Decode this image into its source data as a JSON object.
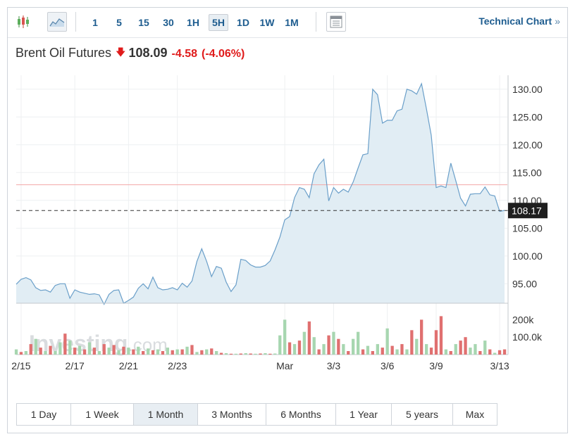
{
  "toolbar": {
    "icons": [
      "candlestick-icon",
      "area-chart-icon",
      "layout-icon"
    ],
    "intervals": [
      "1",
      "5",
      "15",
      "30",
      "1H",
      "5H",
      "1D",
      "1W",
      "1M"
    ],
    "active_interval": "5H",
    "technical_chart_label": "Technical Chart",
    "technical_chart_chevron": "»"
  },
  "quote": {
    "name": "Brent Oil Futures",
    "direction": "down",
    "price": "108.09",
    "change": "-4.58",
    "change_pct": "(-4.06%)"
  },
  "watermark": {
    "brand": "Investing",
    "suffix": ".com"
  },
  "ranges": [
    "1 Day",
    "1 Week",
    "1 Month",
    "3 Months",
    "6 Months",
    "1 Year",
    "5 years",
    "Max"
  ],
  "active_range": "1 Month",
  "colors": {
    "line": "#6a9fc9",
    "area_fill": "#e1edf4",
    "prev_close_line": "#f2a7a7",
    "vol_up": "#a7d6b0",
    "vol_down": "#e07070",
    "accent": "#1d5c8f",
    "down": "#e01b1b"
  },
  "chart_data": {
    "type": "area",
    "series_name": "",
    "price_axis": {
      "ticks": [
        "130.00",
        "125.00",
        "120.00",
        "115.00",
        "110.00",
        "105.00",
        "100.00",
        "95.00"
      ],
      "range": [
        91.5,
        132.5
      ]
    },
    "current_price_label": "108.17",
    "current_price": 108.17,
    "reference_line": 112.8,
    "volume_axis": {
      "ticks": [
        "200k",
        "100.0k"
      ],
      "range": [
        0,
        270
      ]
    },
    "x_ticks": [
      {
        "label": "2/15",
        "index": 1
      },
      {
        "label": "2/17",
        "index": 12
      },
      {
        "label": "2/21",
        "index": 23
      },
      {
        "label": "2/23",
        "index": 33
      },
      {
        "label": "Mar",
        "index": 55
      },
      {
        "label": "3/3",
        "index": 65
      },
      {
        "label": "3/6",
        "index": 76
      },
      {
        "label": "3/9",
        "index": 86
      },
      {
        "label": "3/13",
        "index": 99
      }
    ],
    "values": [
      94.9,
      95.8,
      96.1,
      95.7,
      94.3,
      93.8,
      93.9,
      93.5,
      94.7,
      95.0,
      95.0,
      92.4,
      93.9,
      93.5,
      93.3,
      93.1,
      93.2,
      93.0,
      91.3,
      93.1,
      93.8,
      93.9,
      91.5,
      92.0,
      92.6,
      94.2,
      95.0,
      94.1,
      96.2,
      94.3,
      93.9,
      94.0,
      94.3,
      93.9,
      95.1,
      94.4,
      95.5,
      99.0,
      101.3,
      99.0,
      96.3,
      98.1,
      97.8,
      95.3,
      93.6,
      94.8,
      99.4,
      99.2,
      98.4,
      98.0,
      98.0,
      98.3,
      99.1,
      101.1,
      103.4,
      106.5,
      107.1,
      110.5,
      112.3,
      112.0,
      110.5,
      114.8,
      116.4,
      117.4,
      109.9,
      112.3,
      111.3,
      112.0,
      111.5,
      113.3,
      115.8,
      118.2,
      118.4,
      130.0,
      129.0,
      123.9,
      124.4,
      124.4,
      126.1,
      126.4,
      130.0,
      129.7,
      129.1,
      131.0,
      126.5,
      121.7,
      112.3,
      112.6,
      112.3,
      116.7,
      113.6,
      110.4,
      109.0,
      111.1,
      111.2,
      111.2,
      112.4,
      111.0,
      110.8,
      108.0,
      108.2
    ],
    "volume": [
      {
        "v": 30,
        "up": true
      },
      {
        "v": 15,
        "up": false
      },
      {
        "v": 20,
        "up": true
      },
      {
        "v": 60,
        "up": false
      },
      {
        "v": 90,
        "up": true
      },
      {
        "v": 40,
        "up": false
      },
      {
        "v": 20,
        "up": true
      },
      {
        "v": 50,
        "up": false
      },
      {
        "v": 20,
        "up": true
      },
      {
        "v": 70,
        "up": true
      },
      {
        "v": 120,
        "up": false
      },
      {
        "v": 80,
        "up": true
      },
      {
        "v": 40,
        "up": false
      },
      {
        "v": 50,
        "up": true
      },
      {
        "v": 30,
        "up": false
      },
      {
        "v": 70,
        "up": true
      },
      {
        "v": 40,
        "up": false
      },
      {
        "v": 20,
        "up": true
      },
      {
        "v": 60,
        "up": false
      },
      {
        "v": 40,
        "up": true
      },
      {
        "v": 55,
        "up": false
      },
      {
        "v": 25,
        "up": true
      },
      {
        "v": 45,
        "up": false
      },
      {
        "v": 40,
        "up": true
      },
      {
        "v": 30,
        "up": false
      },
      {
        "v": 45,
        "up": true
      },
      {
        "v": 20,
        "up": false
      },
      {
        "v": 35,
        "up": true
      },
      {
        "v": 25,
        "up": false
      },
      {
        "v": 30,
        "up": true
      },
      {
        "v": 20,
        "up": false
      },
      {
        "v": 40,
        "up": true
      },
      {
        "v": 25,
        "up": false
      },
      {
        "v": 30,
        "up": true
      },
      {
        "v": 30,
        "up": false
      },
      {
        "v": 45,
        "up": true
      },
      {
        "v": 55,
        "up": false
      },
      {
        "v": 15,
        "up": true
      },
      {
        "v": 25,
        "up": false
      },
      {
        "v": 30,
        "up": true
      },
      {
        "v": 35,
        "up": false
      },
      {
        "v": 20,
        "up": true
      },
      {
        "v": 10,
        "up": false
      },
      {
        "v": 8,
        "up": true
      },
      {
        "v": 5,
        "up": false
      },
      {
        "v": 5,
        "up": true
      },
      {
        "v": 6,
        "up": false
      },
      {
        "v": 8,
        "up": true
      },
      {
        "v": 6,
        "up": false
      },
      {
        "v": 5,
        "up": true
      },
      {
        "v": 6,
        "up": false
      },
      {
        "v": 8,
        "up": true
      },
      {
        "v": 5,
        "up": false
      },
      {
        "v": 6,
        "up": true
      },
      {
        "v": 110,
        "up": true
      },
      {
        "v": 200,
        "up": true
      },
      {
        "v": 70,
        "up": false
      },
      {
        "v": 60,
        "up": true
      },
      {
        "v": 80,
        "up": false
      },
      {
        "v": 130,
        "up": true
      },
      {
        "v": 190,
        "up": false
      },
      {
        "v": 100,
        "up": true
      },
      {
        "v": 30,
        "up": false
      },
      {
        "v": 60,
        "up": true
      },
      {
        "v": 110,
        "up": false
      },
      {
        "v": 130,
        "up": true
      },
      {
        "v": 90,
        "up": false
      },
      {
        "v": 60,
        "up": true
      },
      {
        "v": 20,
        "up": false
      },
      {
        "v": 90,
        "up": true
      },
      {
        "v": 130,
        "up": true
      },
      {
        "v": 30,
        "up": false
      },
      {
        "v": 50,
        "up": true
      },
      {
        "v": 20,
        "up": false
      },
      {
        "v": 60,
        "up": true
      },
      {
        "v": 40,
        "up": false
      },
      {
        "v": 150,
        "up": true
      },
      {
        "v": 50,
        "up": false
      },
      {
        "v": 30,
        "up": true
      },
      {
        "v": 60,
        "up": false
      },
      {
        "v": 30,
        "up": true
      },
      {
        "v": 140,
        "up": false
      },
      {
        "v": 90,
        "up": true
      },
      {
        "v": 200,
        "up": false
      },
      {
        "v": 60,
        "up": true
      },
      {
        "v": 40,
        "up": false
      },
      {
        "v": 140,
        "up": false
      },
      {
        "v": 220,
        "up": false
      },
      {
        "v": 30,
        "up": true
      },
      {
        "v": 20,
        "up": false
      },
      {
        "v": 60,
        "up": true
      },
      {
        "v": 80,
        "up": false
      },
      {
        "v": 100,
        "up": false
      },
      {
        "v": 40,
        "up": true
      },
      {
        "v": 60,
        "up": true
      },
      {
        "v": 20,
        "up": false
      },
      {
        "v": 80,
        "up": true
      },
      {
        "v": 30,
        "up": false
      },
      {
        "v": 10,
        "up": true
      },
      {
        "v": 25,
        "up": false
      },
      {
        "v": 30,
        "up": false
      }
    ]
  }
}
